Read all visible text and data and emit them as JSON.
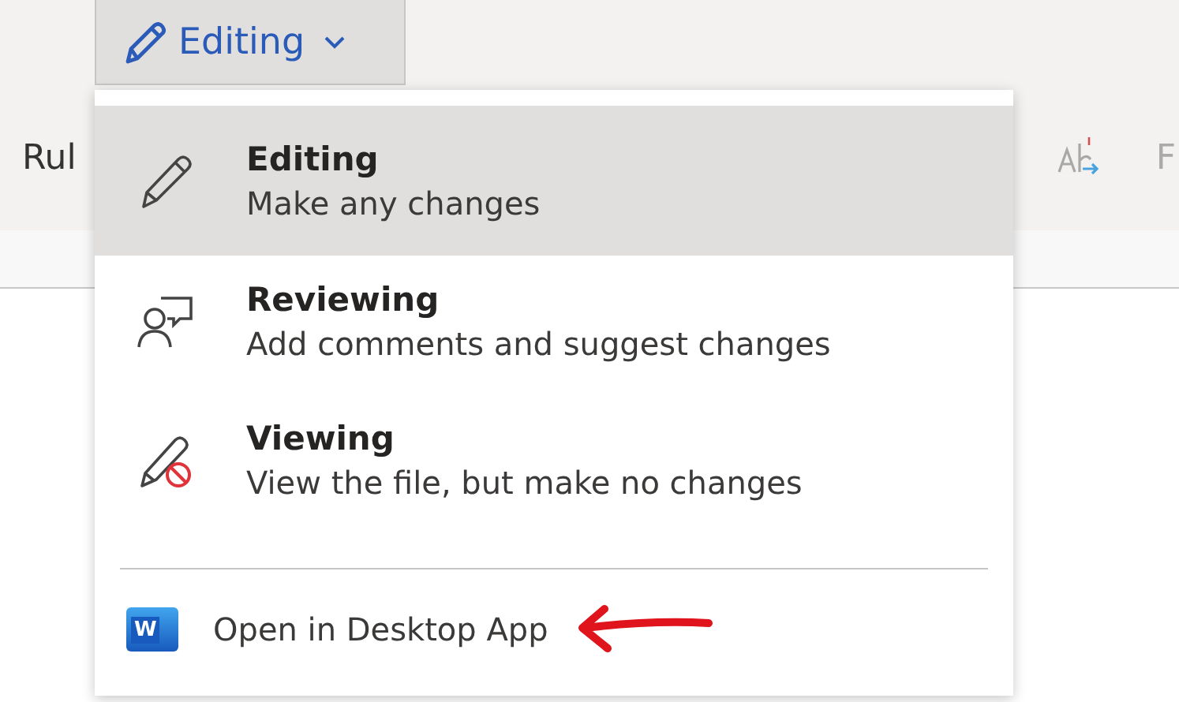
{
  "mode_button": {
    "label": "Editing"
  },
  "ribbon": {
    "left_label": "Rul",
    "right_label": "F"
  },
  "menu": {
    "items": [
      {
        "kind": "editing",
        "title": "Editing",
        "subtitle": "Make any changes",
        "selected": true
      },
      {
        "kind": "reviewing",
        "title": "Reviewing",
        "subtitle": "Add comments and suggest changes",
        "selected": false
      },
      {
        "kind": "viewing",
        "title": "Viewing",
        "subtitle": "View the file, but make no changes",
        "selected": false
      }
    ],
    "footer": {
      "label": "Open in Desktop App",
      "icon_letter": "W"
    }
  }
}
